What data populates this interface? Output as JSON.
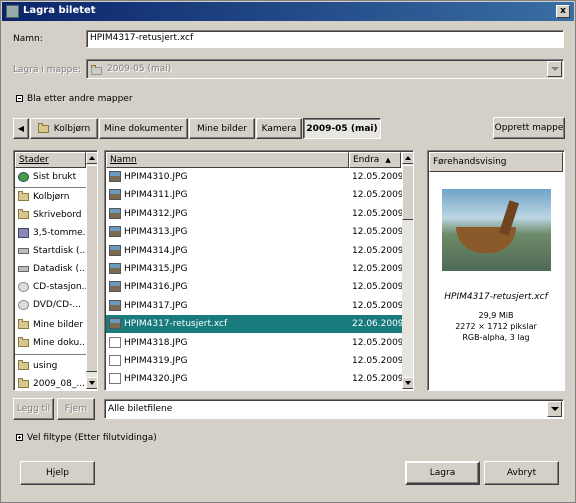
{
  "window": {
    "title": "Lagra biletet",
    "close_glyph": "x"
  },
  "name_label": "Namn:",
  "name_value": "HPIM4317-retusjert.xcf",
  "save_in_label": "Lagra i mappe:",
  "save_in_value": "2009-05 (mai)",
  "browse_label": "Bla etter andre mapper",
  "path_back_glyph": "◀",
  "path_buttons": [
    "Kolbjørn",
    "Mine dokumenter",
    "Mine bilder",
    "Kamera",
    "2009-05 (mai)"
  ],
  "create_folder_label": "Opprett mappe",
  "places": {
    "header": "Stader",
    "items": [
      {
        "label": "Sist brukt",
        "icon": "recent-icon"
      },
      {
        "label": "Kolbjørn",
        "icon": "folder-icon"
      },
      {
        "label": "Skrivebord",
        "icon": "folder-icon"
      },
      {
        "label": "3,5-tomme...",
        "icon": "floppy-icon"
      },
      {
        "label": "Startdisk (...",
        "icon": "harddisk-icon"
      },
      {
        "label": "Datadisk (...",
        "icon": "harddisk-icon"
      },
      {
        "label": "CD-stasjon...",
        "icon": "cdrom-icon"
      },
      {
        "label": "DVD/CD-...",
        "icon": "cdrom-icon"
      },
      {
        "label": "Mine bilder",
        "icon": "folder-icon"
      },
      {
        "label": "Mine doku...",
        "icon": "folder-icon"
      },
      {
        "label": "using",
        "icon": "folder-icon"
      },
      {
        "label": "2009_08_...",
        "icon": "folder-icon"
      }
    ]
  },
  "files": {
    "col_name": "Namn",
    "col_modified": "Endra",
    "sort_glyph": "▲",
    "rows": [
      {
        "name": "HPIM4310.JPG",
        "date": "12.05.2009",
        "icon": "image-icon"
      },
      {
        "name": "HPIM4311.JPG",
        "date": "12.05.2009",
        "icon": "image-icon"
      },
      {
        "name": "HPIM4312.JPG",
        "date": "12.05.2009",
        "icon": "image-icon"
      },
      {
        "name": "HPIM4313.JPG",
        "date": "12.05.2009",
        "icon": "image-icon"
      },
      {
        "name": "HPIM4314.JPG",
        "date": "12.05.2009",
        "icon": "image-icon"
      },
      {
        "name": "HPIM4315.JPG",
        "date": "12.05.2009",
        "icon": "image-icon"
      },
      {
        "name": "HPIM4316.JPG",
        "date": "12.05.2009",
        "icon": "image-icon"
      },
      {
        "name": "HPIM4317.JPG",
        "date": "12.05.2009",
        "icon": "image-icon"
      },
      {
        "name": "HPIM4317-retusjert.xcf",
        "date": "22.06.2009",
        "icon": "xcf-icon",
        "selected": true
      },
      {
        "name": "HPIM4318.JPG",
        "date": "12.05.2009",
        "icon": "document-icon"
      },
      {
        "name": "HPIM4319.JPG",
        "date": "12.05.2009",
        "icon": "document-icon"
      },
      {
        "name": "HPIM4320.JPG",
        "date": "12.05.2009",
        "icon": "document-icon"
      }
    ]
  },
  "preview": {
    "header": "Førehandsvising",
    "filename": "HPIM4317-retusjert.xcf",
    "size": "29,9 MiB",
    "dimensions": "2272 × 1712 pikslar",
    "mode": "RGB-alpha, 3 lag"
  },
  "add_label": "Legg til",
  "remove_label": "Fjern",
  "filter_value": "Alle biletfilene",
  "file_type_label": "Vel filtype (Etter filutvidinga)",
  "help_label": "Hjelp",
  "save_label": "Lagra",
  "cancel_label": "Avbryt",
  "colors": {
    "title_bar": "#0a246a",
    "selection": "#197b7b",
    "dialog_bg": "#d4d0c8"
  }
}
